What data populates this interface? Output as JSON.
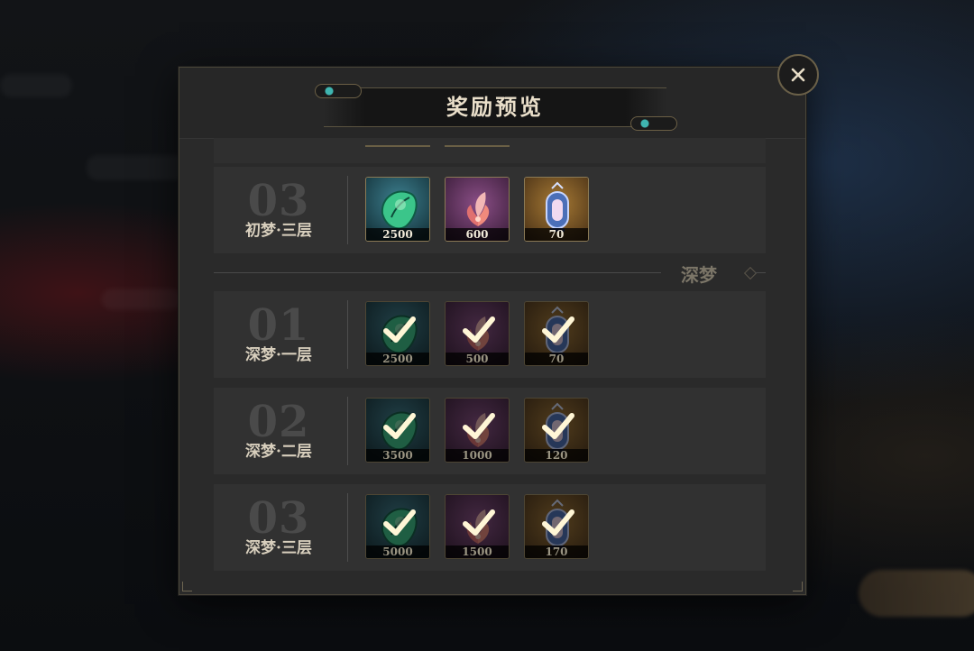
{
  "dialog": {
    "title": "奖励预览",
    "close_icon": "close-x-icon"
  },
  "colors": {
    "accent_gold": "#8b7a55",
    "title_text": "#eadfca",
    "panel": "#2a2a2a",
    "row": "#313131"
  },
  "sections": [
    {
      "label": "深梦"
    }
  ],
  "tiers": [
    {
      "num": "03",
      "name": "初梦·三层",
      "claimed": false,
      "rewards": [
        {
          "icon": "green-leaf-crystal-icon",
          "qty": "2500"
        },
        {
          "icon": "pink-flower-icon",
          "qty": "600"
        },
        {
          "icon": "lantern-icon",
          "qty": "70"
        }
      ]
    },
    {
      "num": "01",
      "name": "深梦·一层",
      "claimed": true,
      "rewards": [
        {
          "icon": "green-leaf-crystal-icon",
          "qty": "2500"
        },
        {
          "icon": "pink-flower-icon",
          "qty": "500"
        },
        {
          "icon": "lantern-icon",
          "qty": "70"
        }
      ]
    },
    {
      "num": "02",
      "name": "深梦·二层",
      "claimed": true,
      "rewards": [
        {
          "icon": "green-leaf-crystal-icon",
          "qty": "3500"
        },
        {
          "icon": "pink-flower-icon",
          "qty": "1000"
        },
        {
          "icon": "lantern-icon",
          "qty": "120"
        }
      ]
    },
    {
      "num": "03",
      "name": "深梦·三层",
      "claimed": true,
      "rewards": [
        {
          "icon": "green-leaf-crystal-icon",
          "qty": "5000"
        },
        {
          "icon": "pink-flower-icon",
          "qty": "1500"
        },
        {
          "icon": "lantern-icon",
          "qty": "170"
        }
      ]
    }
  ]
}
